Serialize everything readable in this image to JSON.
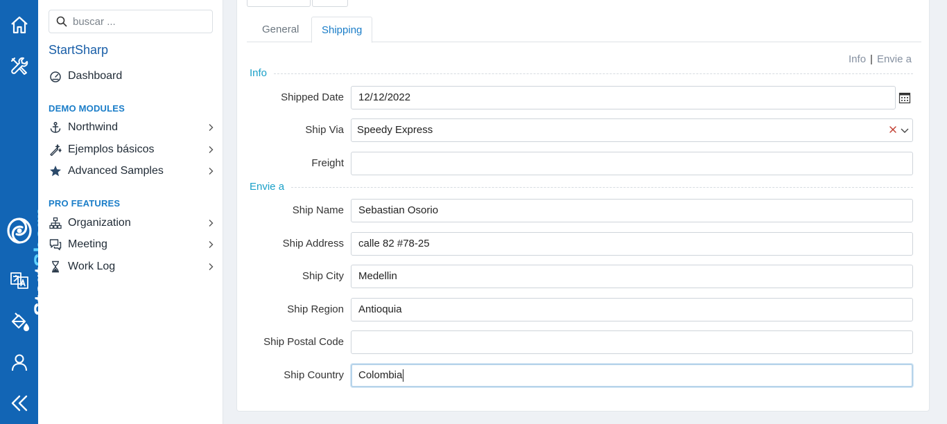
{
  "rail": {
    "brand_part1": "Start",
    "brand_part2": "Sharp",
    "icons": [
      "home-icon",
      "tools-icon",
      "translate-icon",
      "paint-bucket-icon",
      "user-icon",
      "collapse-icon"
    ]
  },
  "sidebar": {
    "search_placeholder": "buscar ...",
    "app_title": "StartSharp",
    "dashboard_label": "Dashboard",
    "demo_header": "DEMO MODULES",
    "demo_items": [
      {
        "label": "Northwind",
        "icon": "anchor-icon"
      },
      {
        "label": "Ejemplos básicos",
        "icon": "magic-wand-icon"
      },
      {
        "label": "Advanced Samples",
        "icon": "star-icon"
      }
    ],
    "pro_header": "PRO FEATURES",
    "pro_items": [
      {
        "label": "Organization",
        "icon": "sitemap-icon"
      },
      {
        "label": "Meeting",
        "icon": "chat-icon"
      },
      {
        "label": "Work Log",
        "icon": "hourglass-icon"
      }
    ]
  },
  "tabs": [
    {
      "label": "General",
      "active": false
    },
    {
      "label": "Shipping",
      "active": true
    }
  ],
  "jump_links": {
    "info": "Info",
    "separator": "|",
    "envie": "Envie a"
  },
  "form": {
    "info_legend": "Info",
    "envie_legend": "Envie a",
    "shipped_date": {
      "label": "Shipped Date",
      "value": "12/12/2022"
    },
    "ship_via": {
      "label": "Ship Via",
      "value": "Speedy Express"
    },
    "freight": {
      "label": "Freight",
      "value": ""
    },
    "ship_name": {
      "label": "Ship Name",
      "value": "Sebastian Osorio"
    },
    "ship_address": {
      "label": "Ship Address",
      "value": "calle 82 #78-25"
    },
    "ship_city": {
      "label": "Ship City",
      "value": "Medellin"
    },
    "ship_region": {
      "label": "Ship Region",
      "value": "Antioquia"
    },
    "ship_postal_code": {
      "label": "Ship Postal Code",
      "value": ""
    },
    "ship_country": {
      "label": "Ship Country",
      "value": "Colombia"
    }
  },
  "colors": {
    "rail": "#1265b5",
    "brand_accent": "#60d3ff",
    "link_blue": "#1a7dc8",
    "legend_teal": "#1aa0c8"
  }
}
